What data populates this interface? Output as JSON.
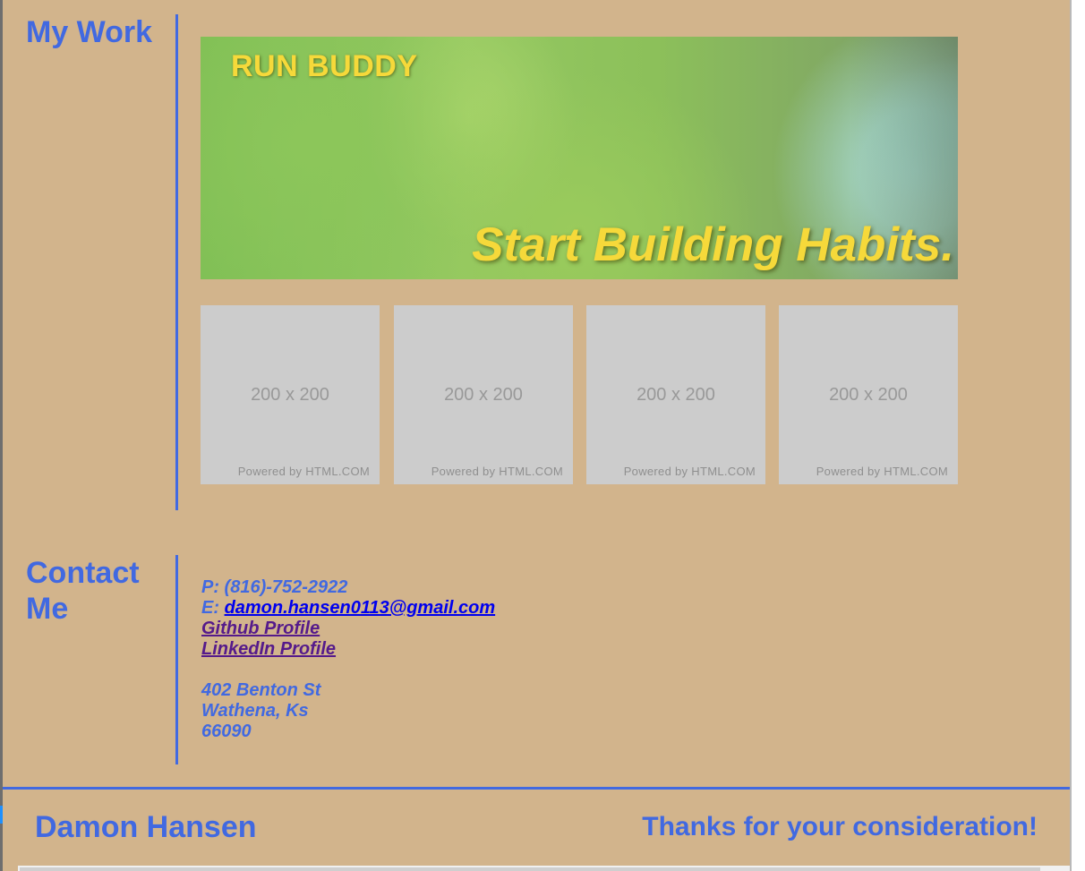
{
  "work": {
    "heading": "My Work",
    "banner": {
      "title": "RUN BUDDY",
      "tagline": "Start Building Habits."
    },
    "thumbnails": [
      {
        "size_label": "200 x 200",
        "powered_label": "Powered by HTML.COM"
      },
      {
        "size_label": "200 x 200",
        "powered_label": "Powered by HTML.COM"
      },
      {
        "size_label": "200 x 200",
        "powered_label": "Powered by HTML.COM"
      },
      {
        "size_label": "200 x 200",
        "powered_label": "Powered by HTML.COM"
      }
    ]
  },
  "contact": {
    "heading_line1": "Contact",
    "heading_line2": "Me",
    "phone": "P: (816)-752-2922",
    "email_prefix": "E: ",
    "email": "damon.hansen0113@gmail.com",
    "github_label": "Github Profile",
    "linkedin_label": "LinkedIn Profile",
    "address": [
      "402 Benton St",
      "Wathena, Ks",
      "66090"
    ]
  },
  "footer": {
    "name": "Damon Hansen",
    "thanks": "Thanks for your consideration!"
  },
  "colors": {
    "background": "#d2b48c",
    "accent": "#4169e1",
    "banner_text": "#f6d93a",
    "link": "#0000ee",
    "link_visited": "#551a8b"
  }
}
